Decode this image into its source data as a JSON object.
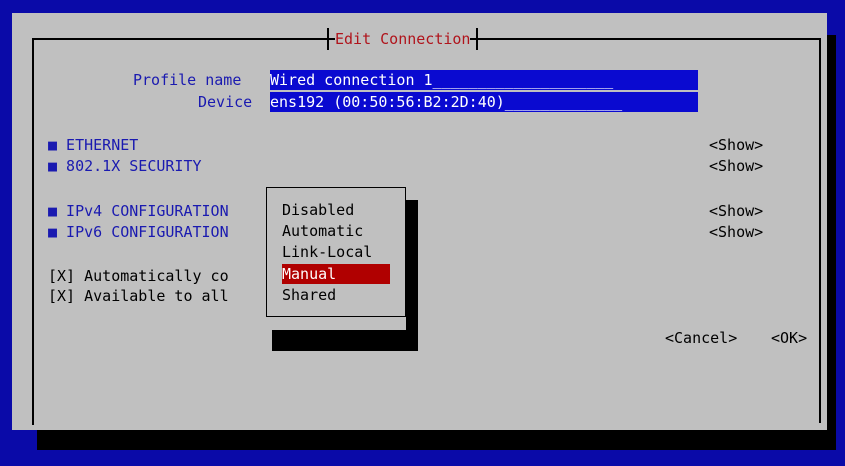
{
  "dialog": {
    "title": "Edit Connection"
  },
  "profile": {
    "name_label": "Profile name",
    "name_value": "Wired connection 1____________________",
    "device_label": "Device",
    "device_value": "ens192 (00:50:56:B2:2D:40)_____________"
  },
  "sections": [
    {
      "label": "■ ETHERNET",
      "action": "<Show>"
    },
    {
      "label": "■ 802.1X SECURITY",
      "action": "<Show>"
    },
    {
      "label": "■ IPv4 CONFIGURATION",
      "action": "<Show>"
    },
    {
      "label": "■ IPv6 CONFIGURATION",
      "action": "<Show>"
    }
  ],
  "checkboxes": [
    {
      "text": "[X] Automatically co"
    },
    {
      "text": "[X] Available to all"
    }
  ],
  "popup": {
    "options": [
      "Disabled",
      "Automatic",
      "Link-Local",
      "Manual",
      "Shared"
    ],
    "selected": "Manual"
  },
  "buttons": {
    "cancel": "<Cancel>",
    "ok": "<OK>"
  },
  "colors": {
    "background": "#0a0aa8",
    "dialog": "#c0c0c0",
    "title": "#b0141c",
    "field": "#0a0ad0",
    "selection": "#b00000"
  }
}
